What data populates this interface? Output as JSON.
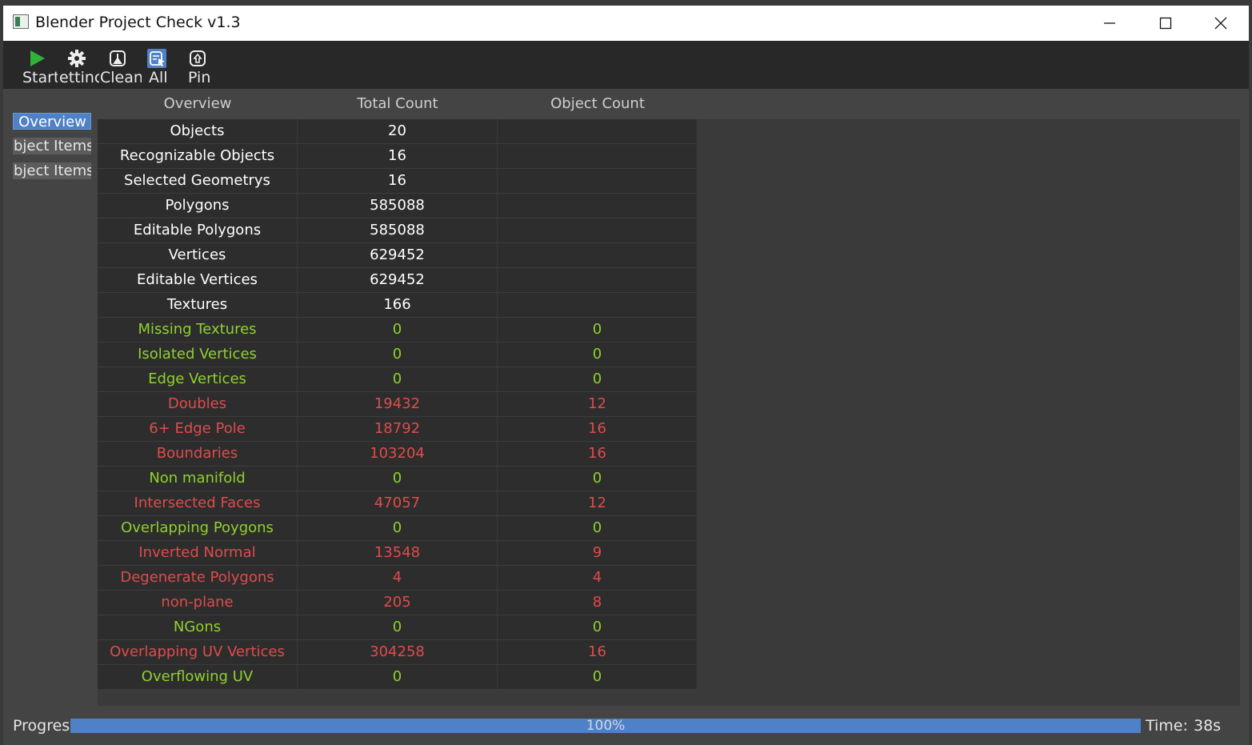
{
  "window": {
    "title": "Blender Project Check v1.3"
  },
  "window_controls": {
    "minimize_icon": "minimize-icon",
    "maximize_icon": "maximize-icon",
    "close_icon": "close-icon"
  },
  "toolbar": {
    "items": [
      {
        "label": "Start",
        "icon": "play-icon"
      },
      {
        "label": "ettinc",
        "icon": "gear-icon"
      },
      {
        "label": "Clean",
        "icon": "clean-icon"
      },
      {
        "label": "All",
        "icon": "select-all-icon"
      },
      {
        "label": "Pin",
        "icon": "pin-icon"
      }
    ]
  },
  "sidebar": {
    "items": [
      {
        "label": "Overview",
        "active": true
      },
      {
        "label": "bject Items"
      },
      {
        "label": "bject Items"
      }
    ]
  },
  "table": {
    "headers": [
      "Overview",
      "Total Count",
      "Object Count"
    ],
    "rows": [
      {
        "name": "Objects",
        "total": "20",
        "object": "",
        "status": "neutral"
      },
      {
        "name": "Recognizable Objects",
        "total": "16",
        "object": "",
        "status": "neutral"
      },
      {
        "name": "Selected Geometrys",
        "total": "16",
        "object": "",
        "status": "neutral"
      },
      {
        "name": "Polygons",
        "total": "585088",
        "object": "",
        "status": "neutral"
      },
      {
        "name": "Editable Polygons",
        "total": "585088",
        "object": "",
        "status": "neutral"
      },
      {
        "name": "Vertices",
        "total": "629452",
        "object": "",
        "status": "neutral"
      },
      {
        "name": "Editable Vertices",
        "total": "629452",
        "object": "",
        "status": "neutral"
      },
      {
        "name": "Textures",
        "total": "166",
        "object": "",
        "status": "neutral"
      },
      {
        "name": "Missing Textures",
        "total": "0",
        "object": "0",
        "status": "ok"
      },
      {
        "name": "Isolated Vertices",
        "total": "0",
        "object": "0",
        "status": "ok"
      },
      {
        "name": "Edge Vertices",
        "total": "0",
        "object": "0",
        "status": "ok"
      },
      {
        "name": "Doubles",
        "total": "19432",
        "object": "12",
        "status": "error"
      },
      {
        "name": "6+ Edge Pole",
        "total": "18792",
        "object": "16",
        "status": "error"
      },
      {
        "name": "Boundaries",
        "total": "103204",
        "object": "16",
        "status": "error"
      },
      {
        "name": "Non manifold",
        "total": "0",
        "object": "0",
        "status": "ok"
      },
      {
        "name": "Intersected Faces",
        "total": "47057",
        "object": "12",
        "status": "error"
      },
      {
        "name": "Overlapping Poygons",
        "total": "0",
        "object": "0",
        "status": "ok"
      },
      {
        "name": "Inverted Normal",
        "total": "13548",
        "object": "9",
        "status": "error"
      },
      {
        "name": "Degenerate Polygons",
        "total": "4",
        "object": "4",
        "status": "error"
      },
      {
        "name": "non-plane",
        "total": "205",
        "object": "8",
        "status": "error"
      },
      {
        "name": "NGons",
        "total": "0",
        "object": "0",
        "status": "ok"
      },
      {
        "name": "Overlapping UV Vertices",
        "total": "304258",
        "object": "16",
        "status": "error"
      },
      {
        "name": "Overflowing UV",
        "total": "0",
        "object": "0",
        "status": "ok"
      }
    ]
  },
  "status": {
    "progress_label": "Progres",
    "progress_value": 1.0,
    "progress_text": "100%",
    "time_label": "Time:",
    "time_value": "38s"
  },
  "colors": {
    "ok": "#8fd12d",
    "error": "#e04b4b",
    "accent": "#4f81c7"
  }
}
